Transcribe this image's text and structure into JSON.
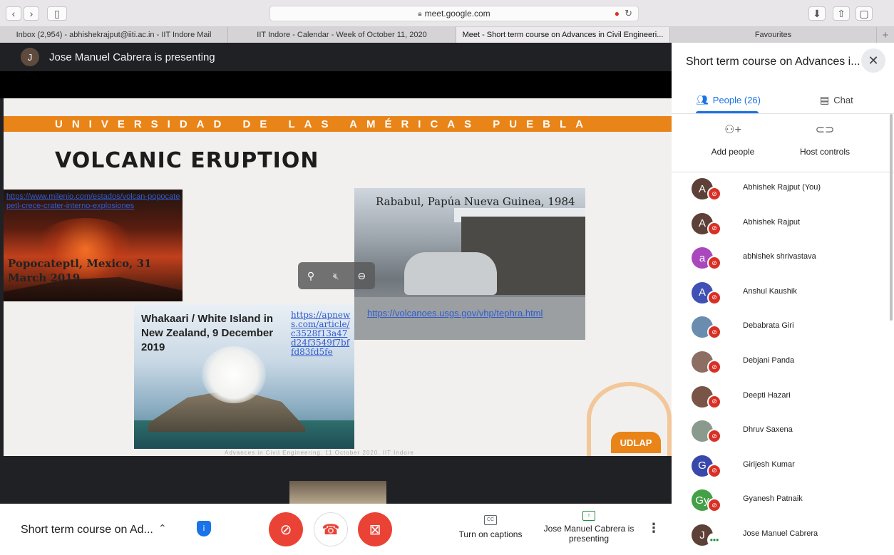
{
  "browser": {
    "url": "meet.google.com",
    "tabs": [
      {
        "label": "Inbox (2,954) - abhishekrajput@iiti.ac.in - IIT Indore Mail"
      },
      {
        "label": "IIT Indore - Calendar - Week of October 11, 2020"
      },
      {
        "label": "Meet - Short term course on Advances in Civil Engineeri..."
      },
      {
        "label": "Favourites"
      }
    ]
  },
  "presenter": {
    "initial": "J",
    "banner_text": "Jose Manuel Cabrera is presenting"
  },
  "slide": {
    "banner": "UNIVERSIDAD DE LAS AMÉRICAS PUEBLA",
    "title": "VOLCANIC ERUPTION",
    "popo_link": "https://www.milenio.com/estados/volcan-popocatepetl-crece-crater-interno-explosiones",
    "popo_caption": "Popocateptl, Mexico, 31 March 2019",
    "rabaul_caption": "Rababul, Papúa Nueva Guinea, 1984",
    "rabaul_link": "https://volcanoes.usgs.gov/vhp/tephra.html",
    "whakaari_caption": "Whakaari / White Island in New Zealand, 9 December 2019",
    "whakaari_link": "https://apnews.com/article/c3528f13a47d24f3549f7bffd83fd5fe",
    "logo": "UDLAP",
    "footer": "Advances in Civil Engineering, 11 October 2020, IIT Indore"
  },
  "bottom_bar": {
    "meeting_title": "Short term course on Ad...",
    "captions_label": "Turn on captions",
    "presenting_label": "Jose Manuel Cabrera is presenting"
  },
  "panel": {
    "title": "Short term course on Advances i...",
    "people_tab": "People (26)",
    "chat_tab": "Chat",
    "add_people": "Add people",
    "host_controls": "Host controls",
    "participants": [
      {
        "name": "Abhishek Rajput (You)",
        "initial": "A",
        "color": "#5d4037"
      },
      {
        "name": "Abhishek Rajput",
        "initial": "A",
        "color": "#5d4037"
      },
      {
        "name": "abhishek shrivastava",
        "initial": "a",
        "color": "#ab47bc"
      },
      {
        "name": "Anshul Kaushik",
        "initial": "A",
        "color": "#3f51b5"
      },
      {
        "name": "Debabrata Giri",
        "initial": "",
        "color": "#6a8caf"
      },
      {
        "name": "Debjani Panda",
        "initial": "",
        "color": "#8d6e63"
      },
      {
        "name": "Deepti Hazari",
        "initial": "",
        "color": "#795548"
      },
      {
        "name": "Dhruv Saxena",
        "initial": "",
        "color": "#8a9a8c"
      },
      {
        "name": "Girijesh Kumar",
        "initial": "G",
        "color": "#3949ab"
      },
      {
        "name": "Gyanesh Patnaik",
        "initial": "Gy",
        "color": "#43a047"
      },
      {
        "name": "Jose Manuel Cabrera",
        "initial": "J",
        "color": "#5d4037"
      }
    ]
  }
}
